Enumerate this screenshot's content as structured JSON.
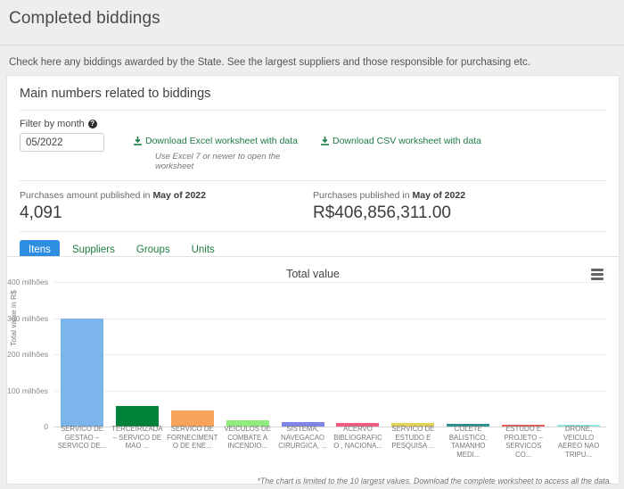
{
  "header": {
    "title": "Completed biddings",
    "subtitle": "Check here any biddings awarded by the State. See the largest suppliers and those responsible for purchasing etc."
  },
  "card": {
    "title": "Main numbers related to biddings"
  },
  "filter": {
    "label": "Filter by month",
    "help_icon": "question-mark-icon",
    "value": "05/2022",
    "placeholder": "MM/YYYY"
  },
  "downloads": {
    "excel_label": "Download Excel worksheet with data",
    "excel_note": "Use Excel 7 or newer to open the worksheet",
    "csv_label": "Download CSV worksheet with data",
    "icon": "download-icon"
  },
  "stats": [
    {
      "label_prefix": "Purchases amount published in ",
      "label_strong": "May of 2022",
      "value": "4,091"
    },
    {
      "label_prefix": "Purchases published in ",
      "label_strong": "May of 2022",
      "value": "R$406,856,311.00"
    }
  ],
  "tabs": [
    {
      "label": "Itens",
      "active": true
    },
    {
      "label": "Suppliers",
      "active": false
    },
    {
      "label": "Groups",
      "active": false
    },
    {
      "label": "Units",
      "active": false
    }
  ],
  "chart_menu_icon": "hamburger-menu-icon",
  "footnote": "*The chart is limited to the 10 largest values. Download the complete worksheet to access all the data.",
  "chart_data": {
    "type": "bar",
    "title": "Total value",
    "xlabel": "",
    "ylabel": "Total value in R$",
    "ylim": [
      0,
      400000000
    ],
    "grid": true,
    "legend": false,
    "ytick_labels": [
      "400 milhões",
      "300 milhões",
      "200 milhões",
      "100 milhões",
      "0"
    ],
    "ytick_values": [
      400000000,
      300000000,
      200000000,
      100000000,
      0
    ],
    "categories": [
      "SERVICO DE GESTAO – SERVICO DE...",
      "TERCEIRIZADA – SERVICO DE MAO ...",
      "SERVICO DE FORNECIMENTO DE ENE...",
      "VEICULOS DE COMBATE A INCENDIO...",
      "SISTEMA, NAVEGACAO CIRURGICA, ...",
      "ACERVO BIBLIOGRAFICO , NACIONA...",
      "SERVICO DE ESTUDO E PESQUISA ...",
      "COLETE BALISTICO, TAMANHO MEDI...",
      "ESTUDO E PROJETO – SERVICOS CO...",
      "DRONE, VEICULO AEREO NAO TRIPU..."
    ],
    "values": [
      300000000,
      56000000,
      44000000,
      18000000,
      13000000,
      11000000,
      9000000,
      7000000,
      6000000,
      3000000
    ],
    "colors": [
      "#7cb5ec",
      "#00823b",
      "#f7a35c",
      "#90ed7d",
      "#8085e9",
      "#f15c80",
      "#e4d354",
      "#2b908f",
      "#f45b5b",
      "#91e8e1"
    ]
  }
}
